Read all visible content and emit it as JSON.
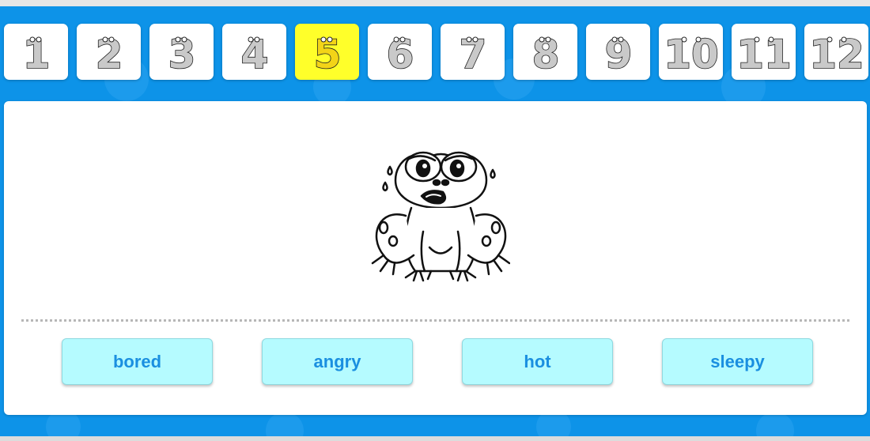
{
  "number_tiles": [
    {
      "label": "1"
    },
    {
      "label": "2"
    },
    {
      "label": "3"
    },
    {
      "label": "4"
    },
    {
      "label": "5"
    },
    {
      "label": "6"
    },
    {
      "label": "7"
    },
    {
      "label": "8"
    },
    {
      "label": "9"
    },
    {
      "label": "10"
    },
    {
      "label": "11"
    },
    {
      "label": "12"
    }
  ],
  "active_tile": "5",
  "picture": {
    "icon": "worried-frog-icon"
  },
  "answers": [
    {
      "label": "bored"
    },
    {
      "label": "angry"
    },
    {
      "label": "hot"
    },
    {
      "label": "sleepy"
    }
  ],
  "colors": {
    "background": "#0d93e8",
    "active_tile": "#ffff2a",
    "answer_bg": "#b5fbff",
    "answer_text": "#1a8fe0"
  }
}
